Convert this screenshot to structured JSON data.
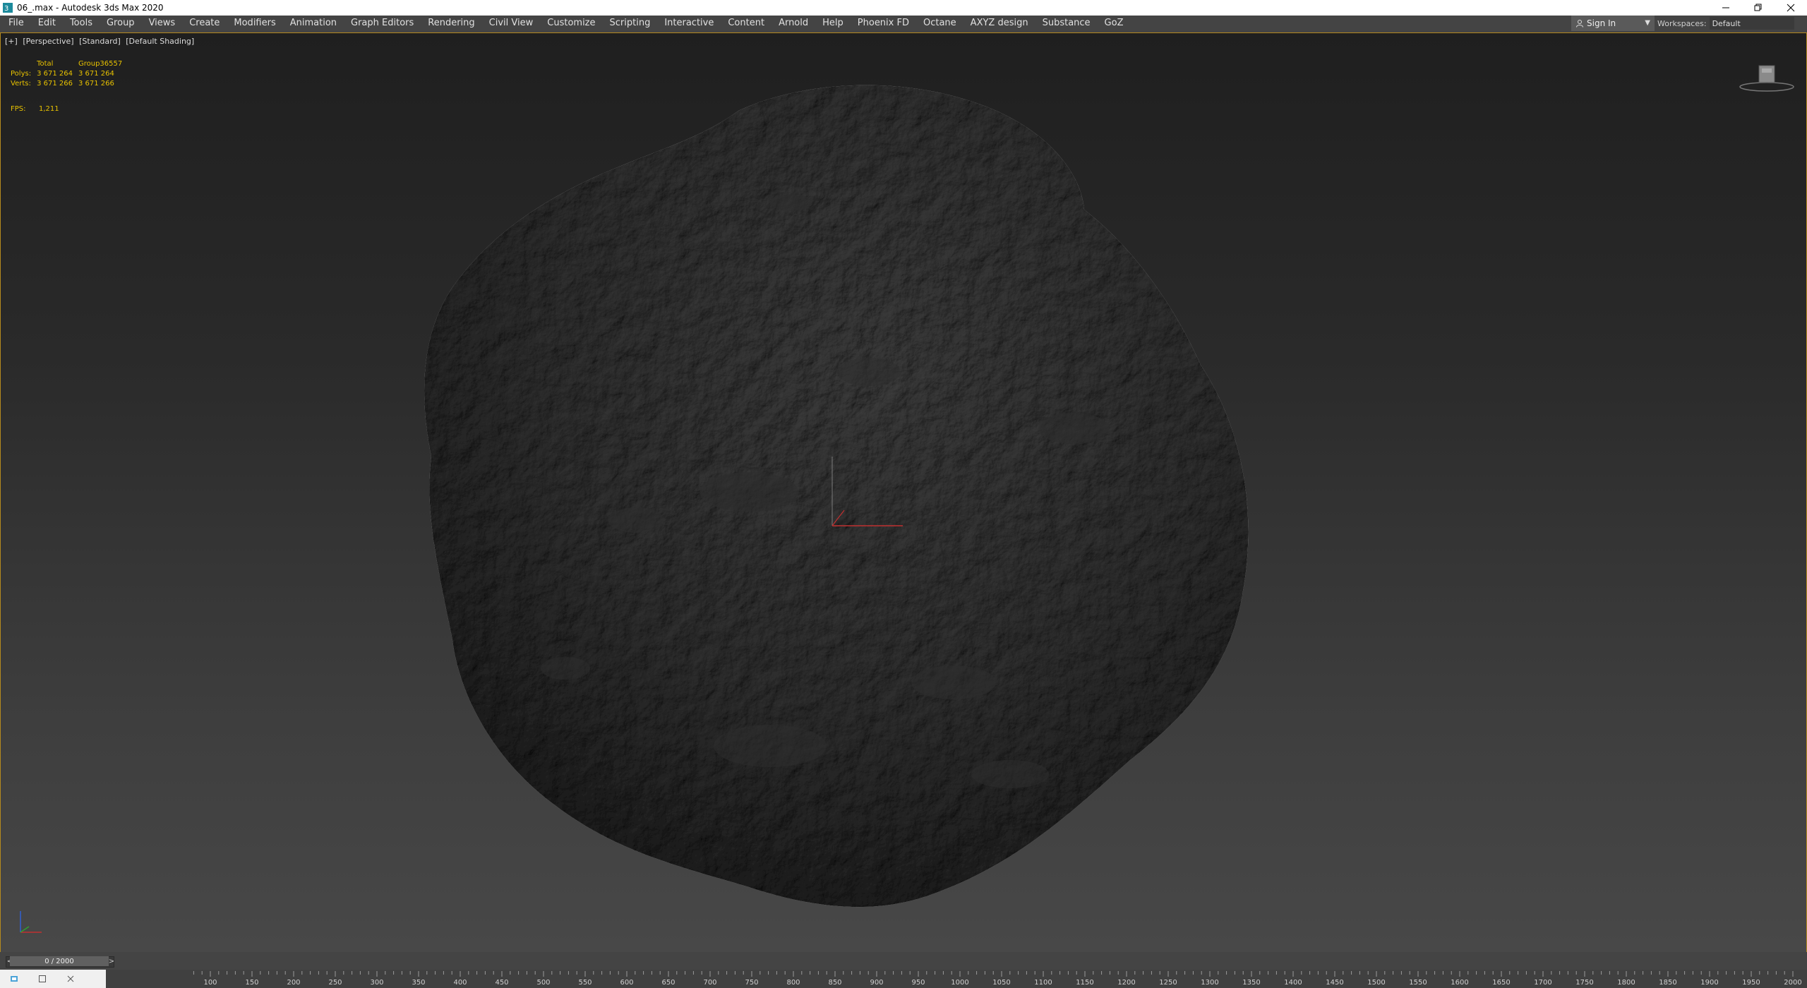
{
  "window": {
    "title": "06_.max - Autodesk 3ds Max 2020",
    "app_icon": "3ds-max-icon",
    "controls": [
      "minimize-icon",
      "restore-icon",
      "close-icon"
    ]
  },
  "menubar": {
    "items": [
      "File",
      "Edit",
      "Tools",
      "Group",
      "Views",
      "Create",
      "Modifiers",
      "Animation",
      "Graph Editors",
      "Rendering",
      "Civil View",
      "Customize",
      "Scripting",
      "Interactive",
      "Content",
      "Arnold",
      "Help",
      "Phoenix FD",
      "Octane",
      "AXYZ design",
      "Substance",
      "GoZ"
    ],
    "sign_in": "Sign In",
    "workspaces_label": "Workspaces:",
    "workspaces_value": "Default"
  },
  "viewport": {
    "labels": [
      "[+]",
      "[Perspective]",
      "[Standard]",
      "[Default Shading]"
    ],
    "stats": {
      "col_total": "Total",
      "col_group": "Group36557",
      "polys_label": "Polys:",
      "polys_total": "3 671 264",
      "polys_group": "3 671 264",
      "verts_label": "Verts:",
      "verts_total": "3 671 266",
      "verts_group": "3 671 266",
      "fps_label": "FPS:",
      "fps_value": "1,211"
    }
  },
  "timeslider": {
    "value": "0 / 2000",
    "prev": "<",
    "next": ">"
  },
  "trackbar": {
    "ticks": [
      "100",
      "150",
      "200",
      "250",
      "300",
      "350",
      "400",
      "450",
      "500",
      "550",
      "600",
      "650",
      "700",
      "750",
      "800",
      "850",
      "900",
      "950",
      "1000",
      "1050",
      "1100",
      "1150",
      "1200",
      "1250",
      "1300",
      "1350",
      "1400",
      "1450",
      "1500",
      "1550",
      "1600",
      "1650",
      "1700",
      "1750",
      "1800",
      "1850",
      "1900",
      "1950",
      "2000"
    ]
  },
  "colors": {
    "viewport_border": "#b58a1e",
    "stats_text": "#e8c200",
    "menubar_bg": "#444444"
  }
}
